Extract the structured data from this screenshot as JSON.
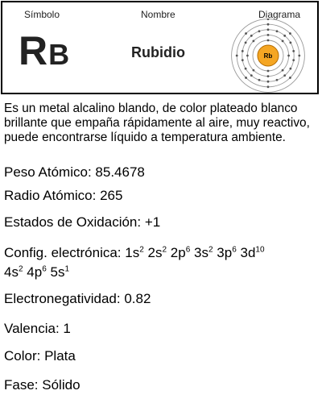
{
  "header": {
    "symbol_label": "Símbolo",
    "name_label": "Nombre",
    "diagram_label": "Diagrama"
  },
  "element": {
    "symbol_first": "R",
    "symbol_second": "B",
    "name": "Rubidio",
    "nucleus_label": "Rb",
    "nucleus_color": "#f5a623",
    "shell_electrons": [
      2,
      8,
      18,
      8,
      1
    ]
  },
  "description": "Es un metal alcalino blando, de color plateado blanco brillante que empaña rápidamente al aire, muy reactivo, puede encontrarse líquido a temperatura ambiente.",
  "properties": {
    "weight_label": "Peso Atómico:",
    "weight_value": "85.4678",
    "radius_label": "Radio Atómico:",
    "radius_value": "265",
    "oxidation_label": "Estados de Oxidación:",
    "oxidation_value": "+1",
    "config_label": "Config. electrónica:",
    "config_line1": [
      {
        "base": "1s",
        "sup": "2"
      },
      {
        "base": "2s",
        "sup": "2"
      },
      {
        "base": "2p",
        "sup": "6"
      },
      {
        "base": "3s",
        "sup": "2"
      },
      {
        "base": "3p",
        "sup": "6"
      },
      {
        "base": "3d",
        "sup": "10"
      }
    ],
    "config_line2": [
      {
        "base": "4s",
        "sup": "2"
      },
      {
        "base": "4p",
        "sup": "6"
      },
      {
        "base": "5s",
        "sup": "1"
      }
    ],
    "electronegativity_label": "Electronegatividad:",
    "electronegativity_value": "0.82",
    "valence_label": "Valencia:",
    "valence_value": "1",
    "color_label": "Color:",
    "color_value": "Plata",
    "phase_label": "Fase:",
    "phase_value": "Sólido"
  }
}
